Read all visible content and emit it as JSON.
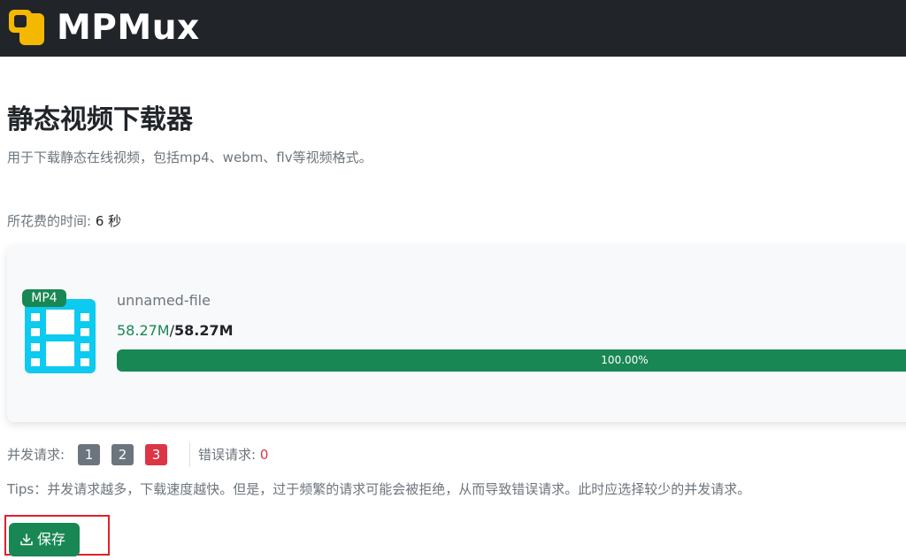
{
  "header": {
    "brand": "MPMux",
    "logo_icon": "logo-square-icon",
    "colors": {
      "background": "#212529",
      "logo": "#f5b800"
    }
  },
  "page": {
    "title": "静态视频下载器",
    "description": "用于下载静态在线视频，包括mp4、webm、flv等视频格式。"
  },
  "elapsed": {
    "label": "所花费的时间:",
    "value": "6 秒"
  },
  "download": {
    "format_badge": "MP4",
    "file_icon": "film-icon",
    "file_name": "unnamed-file",
    "downloaded": "58.27M",
    "separator": "/",
    "total": "58.27M",
    "progress": 1.0,
    "progress_text": "100.00%",
    "colors": {
      "progress": "#198754",
      "film_icon": "#0dcaf0"
    }
  },
  "concurrency": {
    "label": "并发请求:",
    "options": [
      "1",
      "2",
      "3"
    ],
    "selected": "3",
    "error_label": "错误请求:",
    "error_count": "0"
  },
  "tips": "Tips：并发请求越多，下载速度越快。但是，过于频繁的请求可能会被拒绝，从而导致错误请求。此时应选择较少的并发请求。",
  "actions": {
    "save_label": "保存",
    "save_icon": "download-icon"
  }
}
